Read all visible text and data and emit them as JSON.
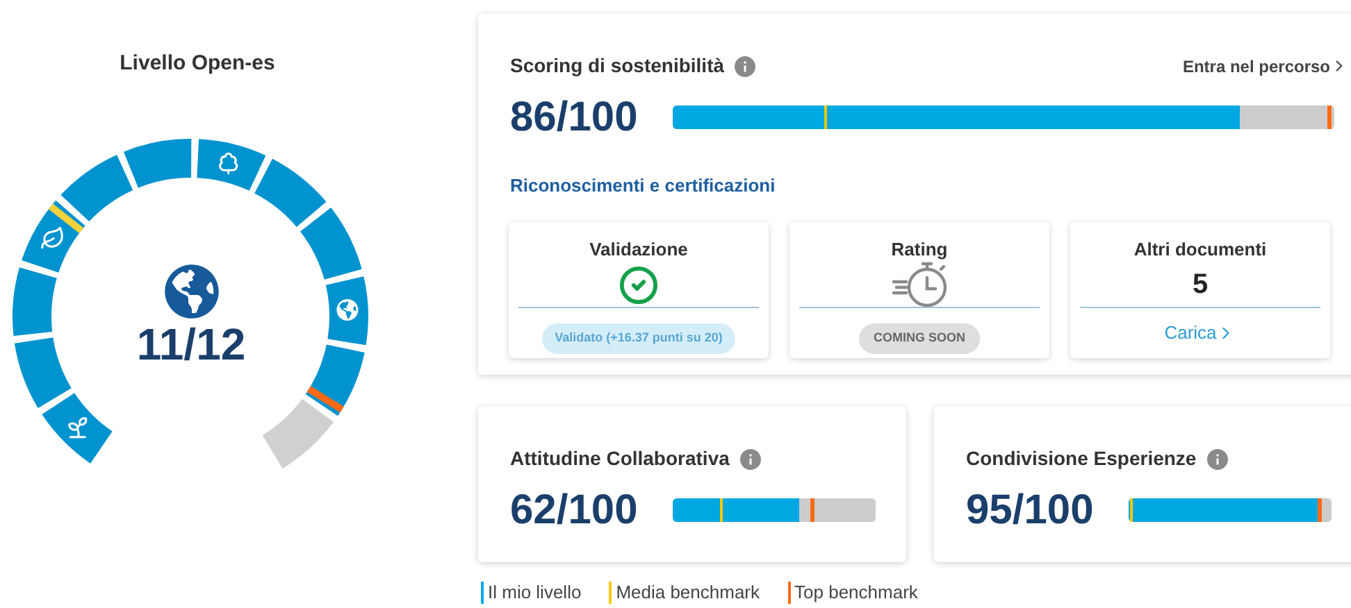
{
  "gauge": {
    "title": "Livello Open-es",
    "score": "11/12",
    "segments": [
      {
        "filled": true,
        "average_marker": false,
        "top_marker": false
      },
      {
        "filled": true,
        "average_marker": false,
        "top_marker": false
      },
      {
        "filled": true,
        "average_marker": false,
        "top_marker": false
      },
      {
        "filled": true,
        "average_marker": true,
        "top_marker": false
      },
      {
        "filled": true,
        "average_marker": false,
        "top_marker": false
      },
      {
        "filled": true,
        "average_marker": false,
        "top_marker": false
      },
      {
        "filled": true,
        "average_marker": false,
        "top_marker": false
      },
      {
        "filled": true,
        "average_marker": false,
        "top_marker": false
      },
      {
        "filled": true,
        "average_marker": false,
        "top_marker": false
      },
      {
        "filled": true,
        "average_marker": false,
        "top_marker": false
      },
      {
        "filled": true,
        "average_marker": false,
        "top_marker": true
      },
      {
        "filled": false,
        "average_marker": false,
        "top_marker": false
      }
    ]
  },
  "scoring": {
    "title": "Scoring di sostenibilità",
    "link": "Entra nel percorso",
    "score": "86/100",
    "bar": {
      "level": 0.857,
      "average_marker": {
        "level": 0.229
      },
      "top_marker": {
        "level": 0.996
      }
    },
    "section_title": "Riconoscimenti e certificazioni",
    "cards": [
      {
        "kind": "status",
        "title": "Validazione",
        "badge": "Validato (+16.37 punti su 20)"
      },
      {
        "kind": "coming",
        "title": "Rating",
        "badge": "COMING SOON"
      },
      {
        "kind": "count",
        "title": "Altri documenti",
        "value": "5",
        "link": "Carica"
      }
    ]
  },
  "metrics": [
    {
      "title": "Attitudine Collaborativa",
      "score": "62/100",
      "bar": {
        "level": 0.62,
        "average_marker": {
          "level": 0.23
        },
        "top_marker": {
          "level": 0.7
        }
      }
    },
    {
      "title": "Condivisione Esperienze",
      "score": "95/100",
      "bar": {
        "level": 0.95,
        "average_marker": {
          "level": 0.01
        },
        "top_marker": {
          "level": 0.95
        }
      }
    }
  ],
  "legend": [
    {
      "label": "Il mio livello",
      "color": "#00a8e1"
    },
    {
      "label": "Media benchmark",
      "color": "#f5c800"
    },
    {
      "label": "Top benchmark",
      "color": "#ff6a13"
    }
  ]
}
